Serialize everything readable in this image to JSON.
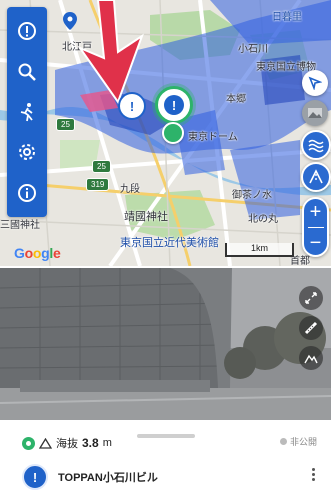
{
  "map": {
    "labels": {
      "kitayomagane": "北江戸",
      "kouishikawa": "小石川",
      "nezu": "日暮里",
      "museum": "東京国立博物",
      "tokyo_dome": "東京ドーム",
      "ochanomizu": "御茶ノ水",
      "yasukuni": "靖國神社",
      "kitanomaru": "北の丸",
      "national_museum_art": "東京国立近代美術館",
      "shrine_left": "三國神社",
      "kudan": "九段",
      "hongo": "本郷",
      "shuto": "首都",
      "google": "Google",
      "scale": "1km"
    },
    "road_numbers": [
      "25",
      "319",
      "25"
    ],
    "colors": {
      "toolbar": "#1f62c9",
      "coverage": "#2f5fe0",
      "arrow": "#e0314a",
      "marker": "#1f62c9",
      "marker_selected": "#2db36a"
    }
  },
  "toolbar": {
    "items": [
      {
        "icon": "alert-icon"
      },
      {
        "icon": "search-icon"
      },
      {
        "icon": "walk-icon"
      },
      {
        "icon": "gear-icon"
      },
      {
        "icon": "info-icon"
      }
    ]
  },
  "map_controls": {
    "zoom_in": "+",
    "zoom_out": "−"
  },
  "sheet": {
    "altitude_label": "海抜",
    "altitude_value": "3.8",
    "altitude_unit": "m",
    "visibility": "非公開",
    "place_icon": "!",
    "place_name": "TOPPAN小石川ビル"
  }
}
